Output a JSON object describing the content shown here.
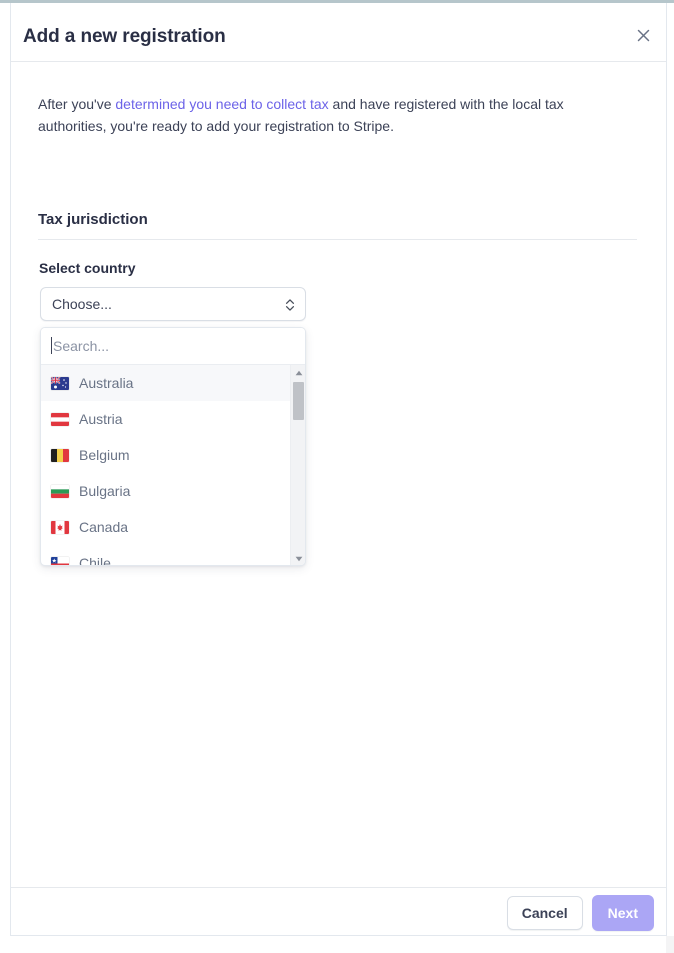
{
  "window": {
    "top_strip_color": "#b6c6cb"
  },
  "modal": {
    "title": "Add a new registration",
    "close_icon": "close-icon",
    "intro": {
      "before_link": "After you've ",
      "link_text": "determined you need to collect tax",
      "after_link": " and have registered with the local tax authorities, you're ready to add your registration to Stripe.",
      "link_color": "#6c63e8"
    },
    "section": {
      "heading": "Tax jurisdiction"
    },
    "country_field": {
      "label": "Select country",
      "select_value": "Choose...",
      "select_icon": "selector-chevrons-icon",
      "expanded": true
    },
    "dropdown": {
      "search_value": "",
      "search_placeholder": "Search...",
      "scrollbar": {
        "up_icon": "triangle-up-icon",
        "down_icon": "triangle-down-icon",
        "thumb_position_percent": 8
      },
      "options": [
        {
          "label": "Australia",
          "flag": "flag-au",
          "highlighted": true
        },
        {
          "label": "Austria",
          "flag": "flag-at",
          "highlighted": false
        },
        {
          "label": "Belgium",
          "flag": "flag-be",
          "highlighted": false
        },
        {
          "label": "Bulgaria",
          "flag": "flag-bg",
          "highlighted": false
        },
        {
          "label": "Canada",
          "flag": "flag-ca",
          "highlighted": false
        },
        {
          "label": "Chile",
          "flag": "flag-cl",
          "highlighted": false
        }
      ]
    },
    "footer": {
      "cancel_label": "Cancel",
      "next_label": "Next",
      "next_color": "#aba6f5",
      "next_disabled": true
    }
  }
}
